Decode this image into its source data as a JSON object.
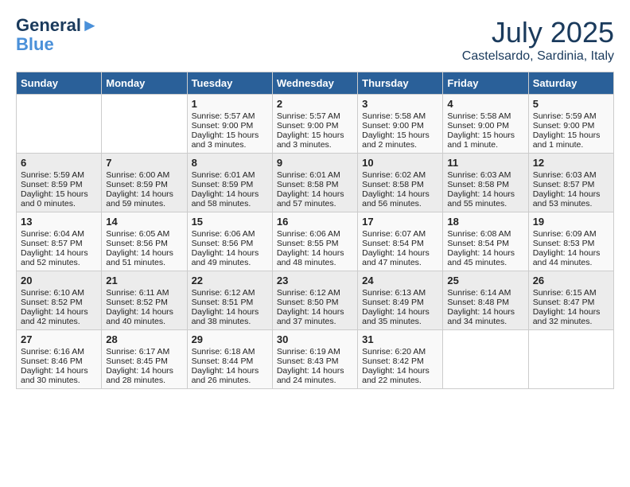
{
  "header": {
    "logo_line1": "General",
    "logo_line2": "Blue",
    "month": "July 2025",
    "location": "Castelsardo, Sardinia, Italy"
  },
  "days_of_week": [
    "Sunday",
    "Monday",
    "Tuesday",
    "Wednesday",
    "Thursday",
    "Friday",
    "Saturday"
  ],
  "weeks": [
    [
      {
        "day": "",
        "content": ""
      },
      {
        "day": "",
        "content": ""
      },
      {
        "day": "1",
        "content": "Sunrise: 5:57 AM\nSunset: 9:00 PM\nDaylight: 15 hours and 3 minutes."
      },
      {
        "day": "2",
        "content": "Sunrise: 5:57 AM\nSunset: 9:00 PM\nDaylight: 15 hours and 3 minutes."
      },
      {
        "day": "3",
        "content": "Sunrise: 5:58 AM\nSunset: 9:00 PM\nDaylight: 15 hours and 2 minutes."
      },
      {
        "day": "4",
        "content": "Sunrise: 5:58 AM\nSunset: 9:00 PM\nDaylight: 15 hours and 1 minute."
      },
      {
        "day": "5",
        "content": "Sunrise: 5:59 AM\nSunset: 9:00 PM\nDaylight: 15 hours and 1 minute."
      }
    ],
    [
      {
        "day": "6",
        "content": "Sunrise: 5:59 AM\nSunset: 8:59 PM\nDaylight: 15 hours and 0 minutes."
      },
      {
        "day": "7",
        "content": "Sunrise: 6:00 AM\nSunset: 8:59 PM\nDaylight: 14 hours and 59 minutes."
      },
      {
        "day": "8",
        "content": "Sunrise: 6:01 AM\nSunset: 8:59 PM\nDaylight: 14 hours and 58 minutes."
      },
      {
        "day": "9",
        "content": "Sunrise: 6:01 AM\nSunset: 8:58 PM\nDaylight: 14 hours and 57 minutes."
      },
      {
        "day": "10",
        "content": "Sunrise: 6:02 AM\nSunset: 8:58 PM\nDaylight: 14 hours and 56 minutes."
      },
      {
        "day": "11",
        "content": "Sunrise: 6:03 AM\nSunset: 8:58 PM\nDaylight: 14 hours and 55 minutes."
      },
      {
        "day": "12",
        "content": "Sunrise: 6:03 AM\nSunset: 8:57 PM\nDaylight: 14 hours and 53 minutes."
      }
    ],
    [
      {
        "day": "13",
        "content": "Sunrise: 6:04 AM\nSunset: 8:57 PM\nDaylight: 14 hours and 52 minutes."
      },
      {
        "day": "14",
        "content": "Sunrise: 6:05 AM\nSunset: 8:56 PM\nDaylight: 14 hours and 51 minutes."
      },
      {
        "day": "15",
        "content": "Sunrise: 6:06 AM\nSunset: 8:56 PM\nDaylight: 14 hours and 49 minutes."
      },
      {
        "day": "16",
        "content": "Sunrise: 6:06 AM\nSunset: 8:55 PM\nDaylight: 14 hours and 48 minutes."
      },
      {
        "day": "17",
        "content": "Sunrise: 6:07 AM\nSunset: 8:54 PM\nDaylight: 14 hours and 47 minutes."
      },
      {
        "day": "18",
        "content": "Sunrise: 6:08 AM\nSunset: 8:54 PM\nDaylight: 14 hours and 45 minutes."
      },
      {
        "day": "19",
        "content": "Sunrise: 6:09 AM\nSunset: 8:53 PM\nDaylight: 14 hours and 44 minutes."
      }
    ],
    [
      {
        "day": "20",
        "content": "Sunrise: 6:10 AM\nSunset: 8:52 PM\nDaylight: 14 hours and 42 minutes."
      },
      {
        "day": "21",
        "content": "Sunrise: 6:11 AM\nSunset: 8:52 PM\nDaylight: 14 hours and 40 minutes."
      },
      {
        "day": "22",
        "content": "Sunrise: 6:12 AM\nSunset: 8:51 PM\nDaylight: 14 hours and 38 minutes."
      },
      {
        "day": "23",
        "content": "Sunrise: 6:12 AM\nSunset: 8:50 PM\nDaylight: 14 hours and 37 minutes."
      },
      {
        "day": "24",
        "content": "Sunrise: 6:13 AM\nSunset: 8:49 PM\nDaylight: 14 hours and 35 minutes."
      },
      {
        "day": "25",
        "content": "Sunrise: 6:14 AM\nSunset: 8:48 PM\nDaylight: 14 hours and 34 minutes."
      },
      {
        "day": "26",
        "content": "Sunrise: 6:15 AM\nSunset: 8:47 PM\nDaylight: 14 hours and 32 minutes."
      }
    ],
    [
      {
        "day": "27",
        "content": "Sunrise: 6:16 AM\nSunset: 8:46 PM\nDaylight: 14 hours and 30 minutes."
      },
      {
        "day": "28",
        "content": "Sunrise: 6:17 AM\nSunset: 8:45 PM\nDaylight: 14 hours and 28 minutes."
      },
      {
        "day": "29",
        "content": "Sunrise: 6:18 AM\nSunset: 8:44 PM\nDaylight: 14 hours and 26 minutes."
      },
      {
        "day": "30",
        "content": "Sunrise: 6:19 AM\nSunset: 8:43 PM\nDaylight: 14 hours and 24 minutes."
      },
      {
        "day": "31",
        "content": "Sunrise: 6:20 AM\nSunset: 8:42 PM\nDaylight: 14 hours and 22 minutes."
      },
      {
        "day": "",
        "content": ""
      },
      {
        "day": "",
        "content": ""
      }
    ]
  ]
}
